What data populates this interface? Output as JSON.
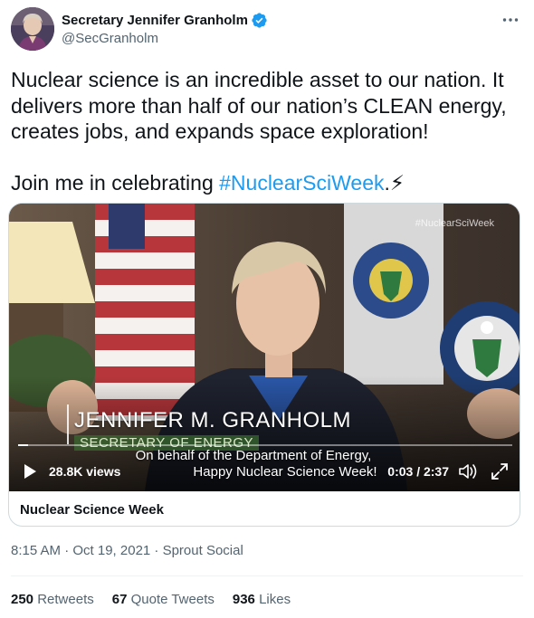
{
  "author": {
    "display_name": "Secretary Jennifer Granholm",
    "handle": "@SecGranholm",
    "verified": true,
    "avatar_icon": "avatar-photo",
    "more_icon": "more-horizontal-icon"
  },
  "tweet": {
    "line_text": "Nuclear science is an incredible asset to our nation. It delivers more than half of our nation’s CLEAN energy, creates jobs, and expands space exploration!",
    "join_prefix": "Join me in celebrating ",
    "hashtag": "#NuclearSciWeek",
    "join_suffix": ".⚡"
  },
  "video": {
    "watermark": "#NuclearSciWeek",
    "lower_third_name": "JENNIFER M. GRANHOLM",
    "lower_third_title": "SECRETARY OF ENERGY",
    "caption_line1": "On behalf of the Department of Energy,",
    "caption_line2": "Happy Nuclear Science Week!",
    "views": "28.8K views",
    "timecode": "0:03 / 2:37",
    "progress_fraction": 0.02,
    "play_icon": "play-icon",
    "volume_icon": "volume-icon",
    "fullscreen_icon": "fullscreen-icon"
  },
  "card": {
    "title": "Nuclear Science Week"
  },
  "meta": {
    "text": "8:15 AM · Oct 19, 2021 · Sprout Social"
  },
  "stats": {
    "retweets_count": "250",
    "retweets_label": "Retweets",
    "quotes_count": "67",
    "quotes_label": "Quote Tweets",
    "likes_count": "936",
    "likes_label": "Likes"
  },
  "colors": {
    "link": "#1d9bf0",
    "text": "#0f1419",
    "secondary": "#536471",
    "border": "#cfd9de"
  }
}
